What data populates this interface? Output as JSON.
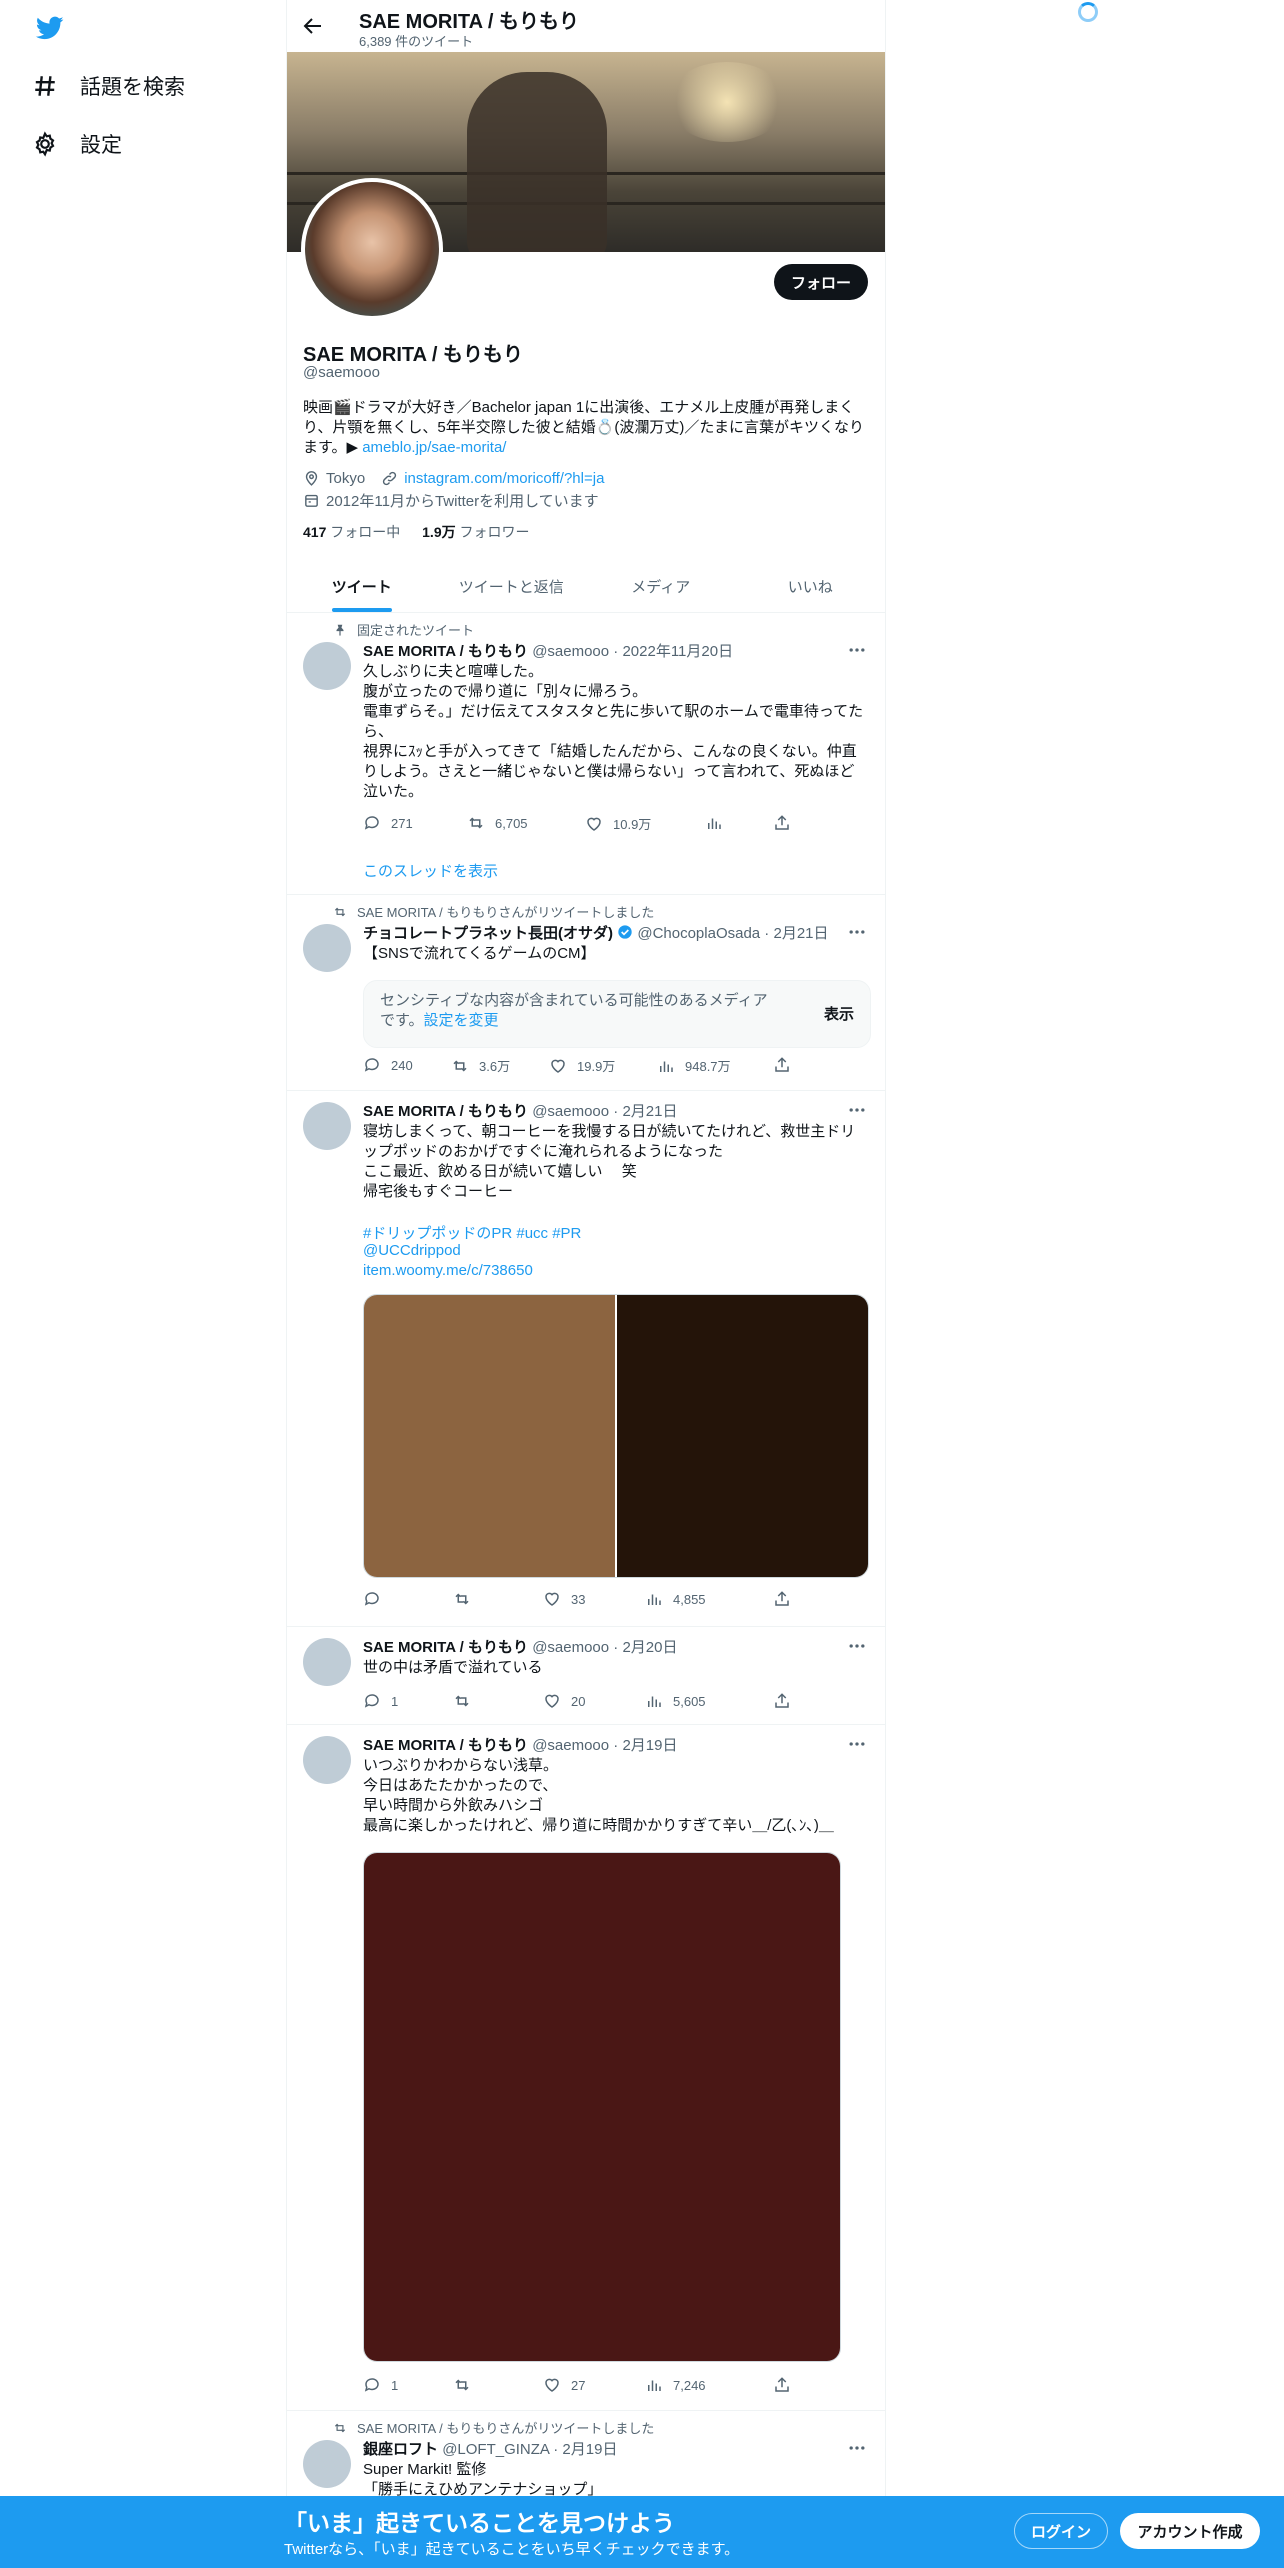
{
  "nav": {
    "items": [
      {
        "label": "話題を検索",
        "icon": "hashtag-icon"
      },
      {
        "label": "設定",
        "icon": "gear-icon"
      }
    ]
  },
  "header": {
    "title": "SAE MORITA / もりもり",
    "tweet_count": "6,389 件のツイート"
  },
  "profile": {
    "name": "SAE MORITA / もりもり",
    "handle": "@saemooo",
    "follow_label": "フォロー",
    "bio_text": "映画🎬ドラマが大好き／Bachelor japan 1に出演後、エナメル上皮腫が再発しまくり、片顎を無くし、5年半交際した彼と結婚💍(波瀾万丈)／たまに言葉がキツくなります。▶ ",
    "bio_link": "ameblo.jp/sae-morita/",
    "location": "Tokyo",
    "website": "instagram.com/moricoff/?hl=ja",
    "joined": "2012年11月からTwitterを利用しています",
    "following_count": "417",
    "following_label": "フォロー中",
    "followers_count": "1.9万",
    "followers_label": "フォロワー"
  },
  "tabs": [
    "ツイート",
    "ツイートと返信",
    "メディア",
    "いいね"
  ],
  "tweets": [
    {
      "context": "固定されたツイート",
      "name": "SAE MORITA / もりもり",
      "meta": "@saemooo · 2022年11月20日",
      "text": "久しぶりに夫と喧嘩した。\n腹が立ったので帰り道に「別々に帰ろう。\n電車ずらそ。」だけ伝えてスタスタと先に歩いて駅のホームで電車待ってたら、\n視界にｽｯと手が入ってきて「結婚したんだから、こんなの良くない。仲直りしよう。さえと一緒じゃないと僕は帰らない」って言われて、死ぬほど泣いた。",
      "replies": "271",
      "retweets": "6,705",
      "likes": "10.9万",
      "views": "",
      "thread_link": "このスレッドを表示"
    },
    {
      "context": "SAE MORITA / もりもりさんがリツイートしました",
      "name": "チョコレートプラネット長田(オサダ)",
      "meta": "@ChocoplaOsada · 2月21日",
      "text": "【SNSで流れてくるゲームのCM】",
      "sensitive_text": "センシティブな内容が含まれている可能性のあるメディアです。",
      "sensitive_link": "設定を変更",
      "sensitive_button": "表示",
      "replies": "240",
      "retweets": "3.6万",
      "likes": "19.9万",
      "views": "948.7万"
    },
    {
      "name": "SAE MORITA / もりもり",
      "meta": "@saemooo · 2月21日",
      "text": "寝坊しまくって、朝コーヒーを我慢する日が続いてたけれど、救世主ドリップポッドのおかげですぐに淹れられるようになった\nここ最近、飲める日が続いて嬉しい　 笑\n帰宅後もすぐコーヒー",
      "tags_line": "#ドリップポッドのPR #ucc #PR",
      "mention": "@UCCdrippod",
      "link": "item.woomy.me/c/738650",
      "image_colors": [
        "#8c6440",
        "#241409"
      ],
      "replies": "",
      "retweets": "",
      "likes": "33",
      "views": "4,855"
    },
    {
      "name": "SAE MORITA / もりもり",
      "meta": "@saemooo · 2月20日",
      "text": "世の中は矛盾で溢れている",
      "replies": "1",
      "retweets": "",
      "likes": "20",
      "views": "5,605"
    },
    {
      "name": "SAE MORITA / もりもり",
      "meta": "@saemooo · 2月19日",
      "text": "いつぶりかわからない浅草。\n今日はあたたかかったので、\n早い時間から外飲みハシゴ\n最高に楽しかったけれど、帰り道に時間かかりすぎて辛い＿/乙(､ﾝ､)＿",
      "image_colors": [
        "#4a1715"
      ],
      "replies": "1",
      "retweets": "",
      "likes": "27",
      "views": "7,246"
    },
    {
      "context": "SAE MORITA / もりもりさんがリツイートしました",
      "name": "銀座ロフト",
      "meta": "@LOFT_GINZA · 2月19日",
      "text": "Super Markit! 監修\n「勝手にえひめアンテナショップ」"
    }
  ],
  "bottom_bar": {
    "title": "「いま」起きていることを見つけよう",
    "subtitle": "Twitterなら、「いま」起きていることをいち早くチェックできます。",
    "login": "ログイン",
    "signup": "アカウント作成"
  },
  "colors": {
    "accent": "#1d9bf0",
    "text": "#0f1419",
    "muted": "#536471"
  }
}
